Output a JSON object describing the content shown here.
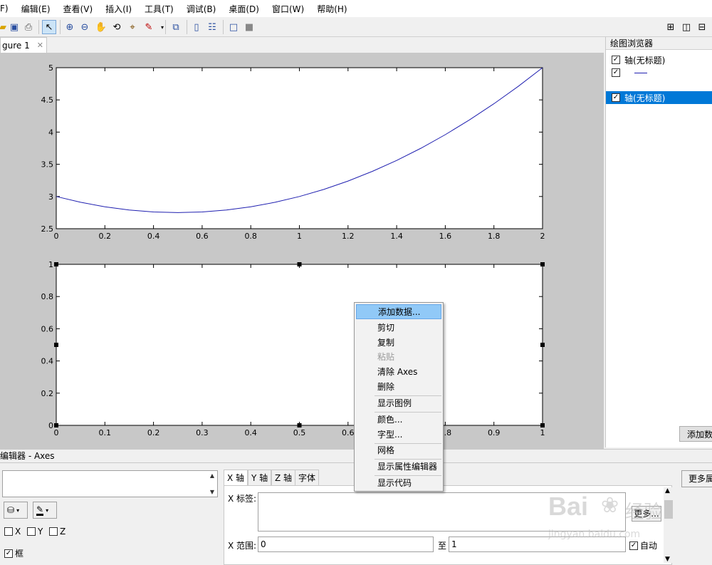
{
  "menubar": {
    "items": [
      "F)",
      "编辑(E)",
      "查看(V)",
      "插入(I)",
      "工具(T)",
      "调试(B)",
      "桌面(D)",
      "窗口(W)",
      "帮助(H)"
    ]
  },
  "toolbar": {
    "icons": [
      "open-icon",
      "save-icon",
      "print-icon",
      "pointer-icon",
      "zoom-in-icon",
      "zoom-out-icon",
      "pan-icon",
      "rotate-icon",
      "data-cursor-icon",
      "brush-icon",
      "link-icon",
      "colorbar-icon",
      "legend-icon",
      "hide-tools-icon",
      "show-tools-icon",
      "tile-icon",
      "split-icon",
      "dock-icon"
    ]
  },
  "figure_tab": {
    "label": "gure 1",
    "close": "✕"
  },
  "plot_browser": {
    "title": "绘图浏览器",
    "items": [
      {
        "label": "轴(无标题)",
        "checked": true,
        "selected": false
      },
      {
        "label": "",
        "checked": true,
        "selected": false,
        "is_line": true
      },
      {
        "label": "轴(无标题)",
        "checked": true,
        "selected": true
      }
    ],
    "add_data_button": "添加数"
  },
  "chart_data": [
    {
      "type": "line",
      "xlim": [
        0,
        2
      ],
      "ylim": [
        2.5,
        5
      ],
      "xticks": [
        "0",
        "0.2",
        "0.4",
        "0.6",
        "0.8",
        "1",
        "1.2",
        "1.4",
        "1.6",
        "1.8",
        "2"
      ],
      "yticks": [
        "2.5",
        "3",
        "3.5",
        "4",
        "4.5",
        "5"
      ],
      "series": [
        {
          "x": [
            0,
            0.1,
            0.2,
            0.3,
            0.4,
            0.5,
            0.6,
            0.7,
            0.8,
            0.9,
            1.0,
            1.1,
            1.2,
            1.3,
            1.4,
            1.5,
            1.6,
            1.7,
            1.8,
            1.9,
            2.0
          ],
          "y": [
            3.0,
            2.91,
            2.84,
            2.79,
            2.76,
            2.75,
            2.76,
            2.79,
            2.84,
            2.91,
            3.0,
            3.11,
            3.24,
            3.39,
            3.56,
            3.75,
            3.96,
            4.19,
            4.44,
            4.71,
            5.0
          ],
          "color": "#1f1fb0"
        }
      ],
      "grid": false
    },
    {
      "type": "line",
      "xlim": [
        0,
        1
      ],
      "ylim": [
        0,
        1
      ],
      "xticks": [
        "0",
        "0.1",
        "0.2",
        "0.3",
        "0.4",
        "0.5",
        "0.6",
        "0.7",
        "0.8",
        "0.9",
        "1"
      ],
      "yticks": [
        "0",
        "0.2",
        "0.4",
        "0.6",
        "0.8",
        "1"
      ],
      "series": [],
      "selected": true,
      "grid": false
    }
  ],
  "context_menu": {
    "items": [
      {
        "label": "添加数据...",
        "highlighted": true
      },
      {
        "label": "剪切"
      },
      {
        "label": "复制"
      },
      {
        "label": "粘贴",
        "disabled": true
      },
      {
        "label": "清除 Axes"
      },
      {
        "label": "删除"
      },
      {
        "label": "显示图例",
        "sep_before": true
      },
      {
        "label": "颜色...",
        "sep_before": true
      },
      {
        "label": "字型..."
      },
      {
        "label": "网格",
        "sep_before": true
      },
      {
        "label": "显示属性编辑器",
        "sep_before": true
      },
      {
        "label": "显示代码",
        "sep_before": true
      }
    ]
  },
  "property_editor": {
    "title": "编辑器 - Axes",
    "more_props_button": "更多属",
    "tabs": [
      "X 轴",
      "Y 轴",
      "Z 轴",
      "字体"
    ],
    "xlabel_label": "X 标签:",
    "more_button": "更多...",
    "xrange_label": "X 范围:",
    "xrange_min": "0",
    "to_label": "至",
    "xrange_max": "1",
    "auto_label": "自动",
    "visibility": [
      {
        "label": "X",
        "checked": false
      },
      {
        "label": "Y",
        "checked": false
      },
      {
        "label": "Z",
        "checked": false
      }
    ],
    "box_label": "框",
    "box_checked": true
  },
  "watermark": {
    "brand": "Bai",
    "brand2": "经验",
    "url": "jingyan.baidu.com"
  }
}
